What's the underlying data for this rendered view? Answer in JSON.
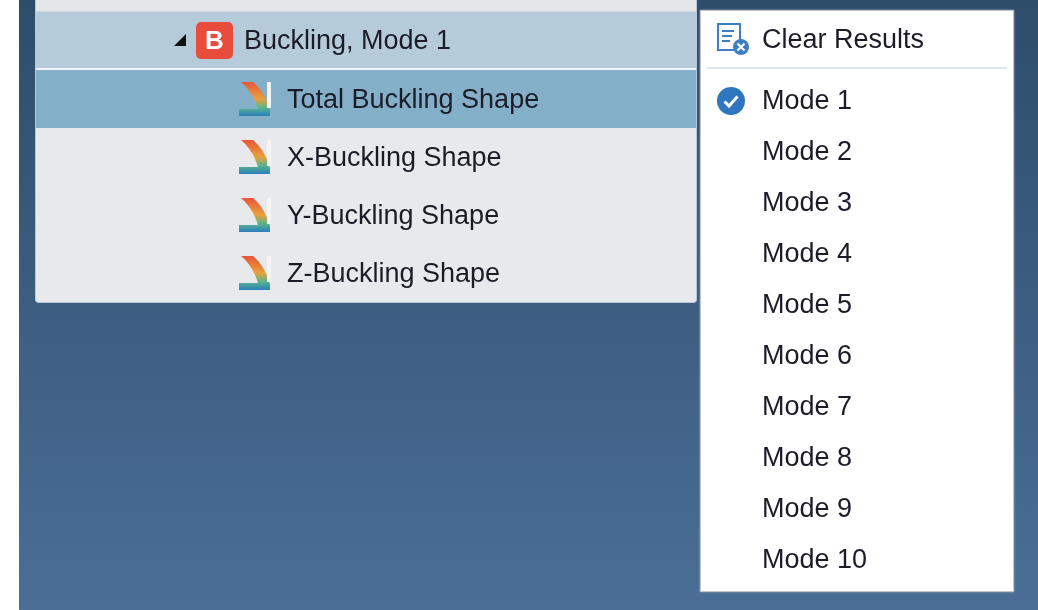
{
  "tree": {
    "node": {
      "label": "Buckling, Mode 1",
      "badge": "B",
      "expanded": true,
      "children": [
        {
          "label": "Total Buckling Shape",
          "selected": true
        },
        {
          "label": "X-Buckling Shape",
          "selected": false
        },
        {
          "label": "Y-Buckling Shape",
          "selected": false
        },
        {
          "label": "Z-Buckling Shape",
          "selected": false
        }
      ]
    }
  },
  "menu": {
    "action": "Clear Results",
    "modes": [
      {
        "label": "Mode 1",
        "checked": true
      },
      {
        "label": "Mode 2",
        "checked": false
      },
      {
        "label": "Mode 3",
        "checked": false
      },
      {
        "label": "Mode 4",
        "checked": false
      },
      {
        "label": "Mode 5",
        "checked": false
      },
      {
        "label": "Mode 6",
        "checked": false
      },
      {
        "label": "Mode 7",
        "checked": false
      },
      {
        "label": "Mode 8",
        "checked": false
      },
      {
        "label": "Mode 9",
        "checked": false
      },
      {
        "label": "Mode 10",
        "checked": false
      }
    ]
  }
}
